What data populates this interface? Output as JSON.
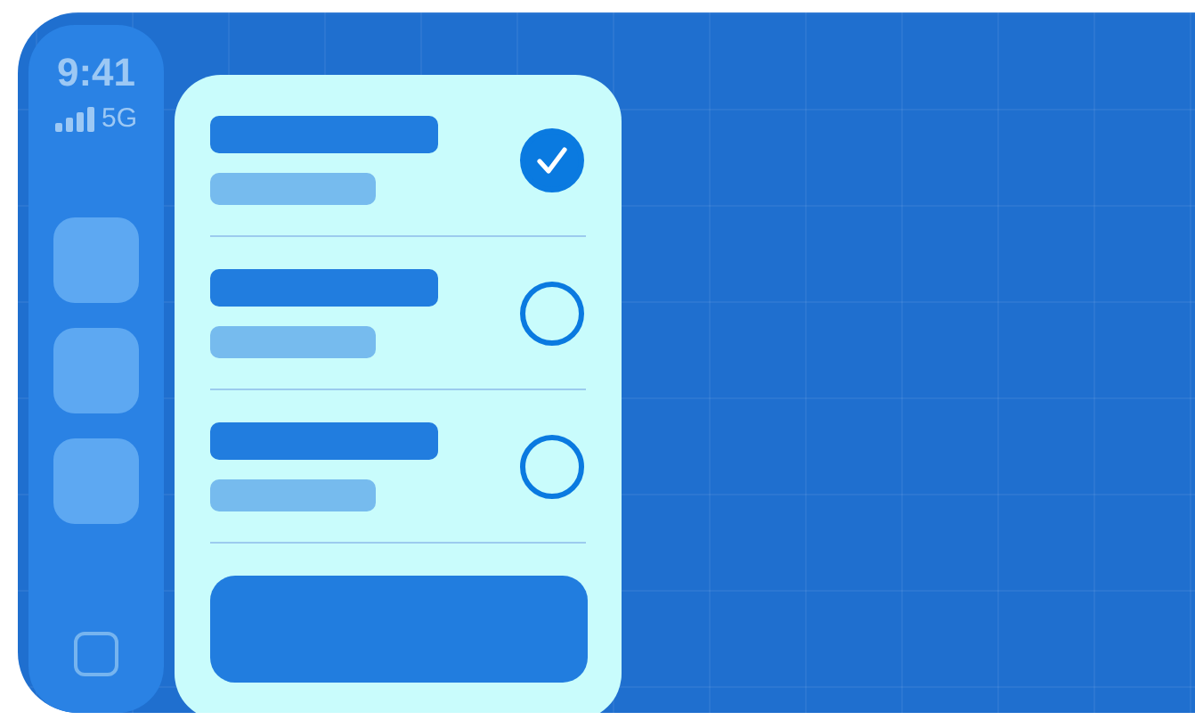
{
  "status": {
    "time": "9:41",
    "network": "5G"
  },
  "options": [
    {
      "selected": true
    },
    {
      "selected": false
    },
    {
      "selected": false
    }
  ]
}
